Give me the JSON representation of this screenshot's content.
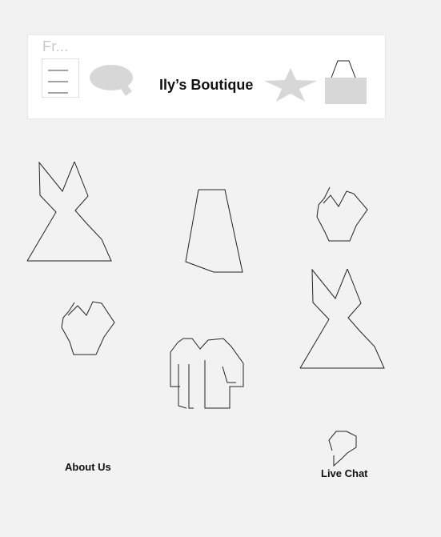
{
  "header": {
    "truncated_label": "Fr...",
    "title": "Ily’s Boutique",
    "icons": {
      "menu": "menu-icon",
      "chat": "chat-icon",
      "favorite": "star-icon",
      "cart": "bag-icon"
    }
  },
  "products": [
    {
      "icon": "dress-icon"
    },
    {
      "icon": "skirt-icon"
    },
    {
      "icon": "top-icon"
    },
    {
      "icon": "dress-icon"
    },
    {
      "icon": "top-icon"
    },
    {
      "icon": "jacket-icon"
    }
  ],
  "footer": {
    "about_label": "About Us",
    "live_chat_label": "Live Chat"
  },
  "colors": {
    "page_background": "#f2f2f2",
    "header_background": "#ffffff",
    "muted_icon": "#d7d7d7",
    "text": "#111111"
  }
}
